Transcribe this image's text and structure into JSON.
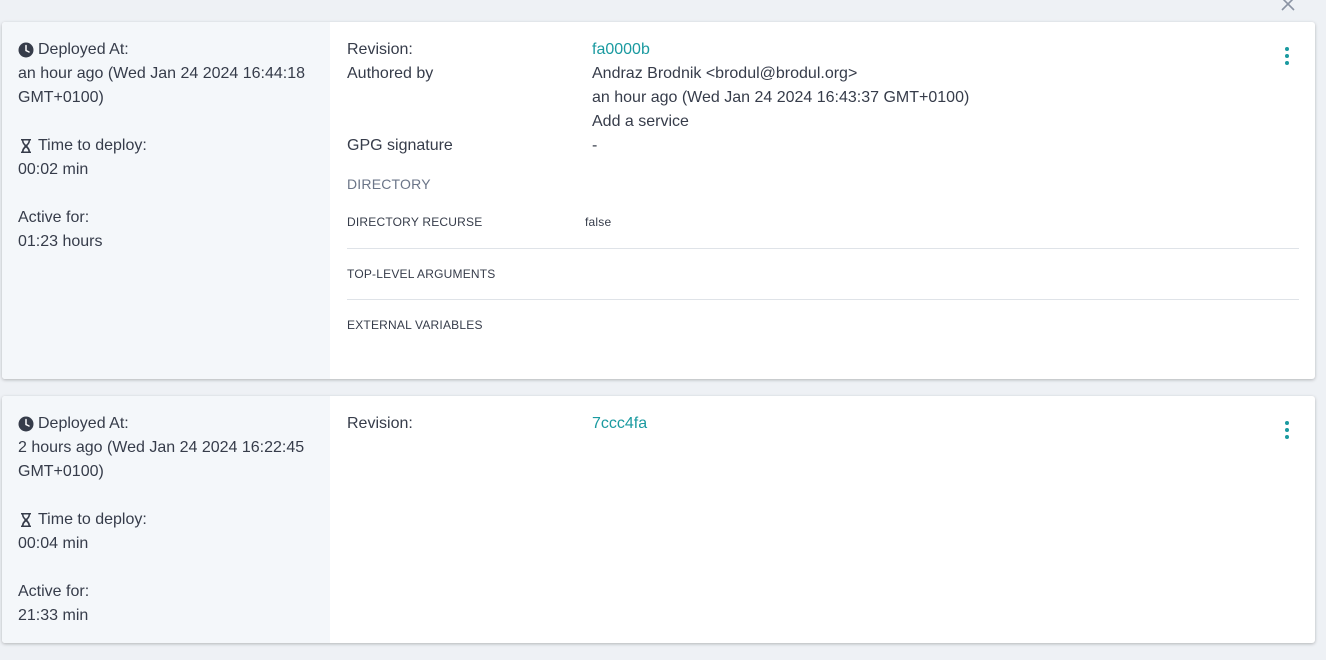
{
  "colors": {
    "accent": "#1a9aa0",
    "text": "#363c4a",
    "muted": "#6b7588",
    "left_panel_bg": "#f4f7fa",
    "page_bg": "#eef1f5"
  },
  "icons": {
    "close": "close-icon",
    "clock": "clock-icon",
    "hourglass": "hourglass-icon",
    "more": "more-vert-icon"
  },
  "deployments": [
    {
      "deployed_at_label": "Deployed At:",
      "deployed_at_value": "an hour ago (Wed Jan 24 2024 16:44:18 GMT+0100)",
      "time_to_deploy_label": "Time to deploy:",
      "time_to_deploy_value": "00:02 min",
      "active_for_label": "Active for:",
      "active_for_value": "01:23 hours",
      "revision_label": "Revision:",
      "revision_value": "fa0000b",
      "authored_by_label": "Authored by",
      "author": "Andraz Brodnik <brodul@brodul.org>",
      "authored_time": "an hour ago (Wed Jan 24 2024 16:43:37 GMT+0100)",
      "commit_message": "Add a service",
      "gpg_label": "GPG signature",
      "gpg_value": "-",
      "section_title": "DIRECTORY",
      "params": [
        {
          "key": "DIRECTORY RECURSE",
          "value": "false"
        },
        {
          "key": "TOP-LEVEL ARGUMENTS",
          "value": ""
        },
        {
          "key": "EXTERNAL VARIABLES",
          "value": ""
        }
      ]
    },
    {
      "deployed_at_label": "Deployed At:",
      "deployed_at_value": "2 hours ago (Wed Jan 24 2024 16:22:45 GMT+0100)",
      "time_to_deploy_label": "Time to deploy:",
      "time_to_deploy_value": "00:04 min",
      "active_for_label": "Active for:",
      "active_for_value": "21:33 min",
      "revision_label": "Revision:",
      "revision_value": "7ccc4fa"
    }
  ]
}
